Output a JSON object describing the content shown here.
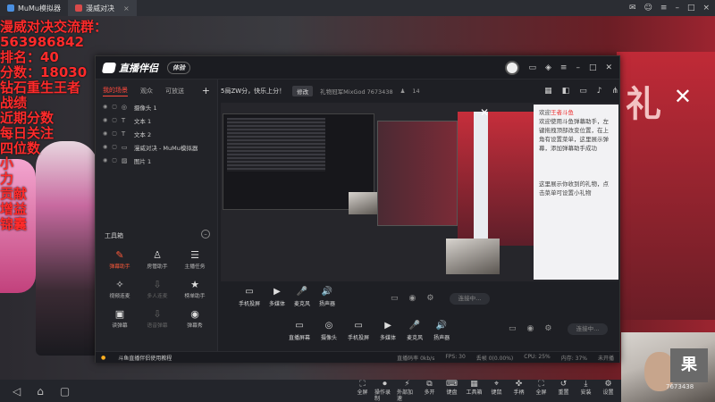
{
  "os_tabs": [
    {
      "label": "MuMu模拟器",
      "active": false
    },
    {
      "label": "漫威对决",
      "active": true
    }
  ],
  "overlay_lines": [
    "漫威对决交流群：",
    "563986842",
    "排名：40",
    "分数：18030",
    "钻石重生王者",
    "战绩",
    "近期分数",
    "每日关注",
    "四位数",
    "小",
    "力",
    "贡献",
    "增益",
    "锦囊"
  ],
  "right_art_text": "礼",
  "app": {
    "name": "直播伴侣",
    "version": "体验",
    "left_tabs": [
      "我的场景",
      "观众",
      "可放送"
    ],
    "scenes": [
      {
        "label": "摄像头 1",
        "icon": "camera-icon"
      },
      {
        "label": "文本 1",
        "icon": "text-icon"
      },
      {
        "label": "文本 2",
        "icon": "text-icon"
      },
      {
        "label": "漫威对决 - MuMu模拟器",
        "icon": "window-icon"
      },
      {
        "label": "图片 1",
        "icon": "image-icon"
      }
    ],
    "tools_title": "工具箱",
    "tools": [
      {
        "label": "弹幕助手",
        "icon": "✎",
        "hot": true,
        "dim": false
      },
      {
        "label": "房管助手",
        "icon": "♙",
        "hot": false,
        "dim": false
      },
      {
        "label": "主播任务",
        "icon": "☰",
        "hot": false,
        "dim": false
      },
      {
        "label": "视频连麦",
        "icon": "✧",
        "hot": false,
        "dim": false
      },
      {
        "label": "多人连麦",
        "icon": "⇩",
        "hot": false,
        "dim": true
      },
      {
        "label": "榜单助手",
        "icon": "★",
        "hot": false,
        "dim": false
      },
      {
        "label": "读弹幕",
        "icon": "▣",
        "hot": false,
        "dim": false
      },
      {
        "label": "语音弹幕",
        "icon": "⇩",
        "hot": false,
        "dim": true
      },
      {
        "label": "弹幕秀",
        "icon": "◉",
        "hot": false,
        "dim": false
      }
    ],
    "preview_title": "5局ZW分，快乐上分！",
    "edit_label": "修改",
    "room_info": "礼物冠军MixGod 7673438",
    "viewer_count": "14",
    "preview_welcome": "欢迎使用斗鱼弹幕助手，左键拖拽顶部改变位置，在上角有设置菜单，这里展示弹幕，添加弹幕助手成功",
    "preview_gift_msg": "这里展示你收到的礼物，点击菜单可设置小礼物",
    "welcome_prefix": "欢迎",
    "welcome_user": "王者斗鱼",
    "controls": [
      {
        "label": "手机投屏",
        "icon": "▭"
      },
      {
        "label": "多媒体",
        "icon": "▶"
      },
      {
        "label": "麦克风",
        "icon": "🎤"
      },
      {
        "label": "扬声器",
        "icon": "🔊"
      }
    ],
    "controls2": [
      {
        "label": "直播屏幕",
        "icon": "▭"
      },
      {
        "label": "摄像头",
        "icon": "◎"
      },
      {
        "label": "手机投屏",
        "icon": "▭"
      },
      {
        "label": "多媒体",
        "icon": "▶"
      },
      {
        "label": "麦克风",
        "icon": "🎤"
      },
      {
        "label": "扬声器",
        "icon": "🔊"
      }
    ],
    "start_label": "连接中...",
    "footer": {
      "warning": "斗鱼直播伴侣使用教程",
      "stats": [
        "直播码率 0kb/s",
        "FPS: 30",
        "丢帧 0(0.00%)",
        "CPU: 25%",
        "内存: 37%",
        "未开播"
      ]
    }
  },
  "cam_number": "7673438",
  "bottom_tools": [
    "全屏",
    "操作录制",
    "外部加速",
    "多开",
    "键盘",
    "工具箱",
    "键鼠",
    "手柄",
    "全屏",
    "重置",
    "安装",
    "设置"
  ],
  "colors": {
    "accent": "#ff4a3d",
    "overlay_red": "#ff2b2b"
  }
}
